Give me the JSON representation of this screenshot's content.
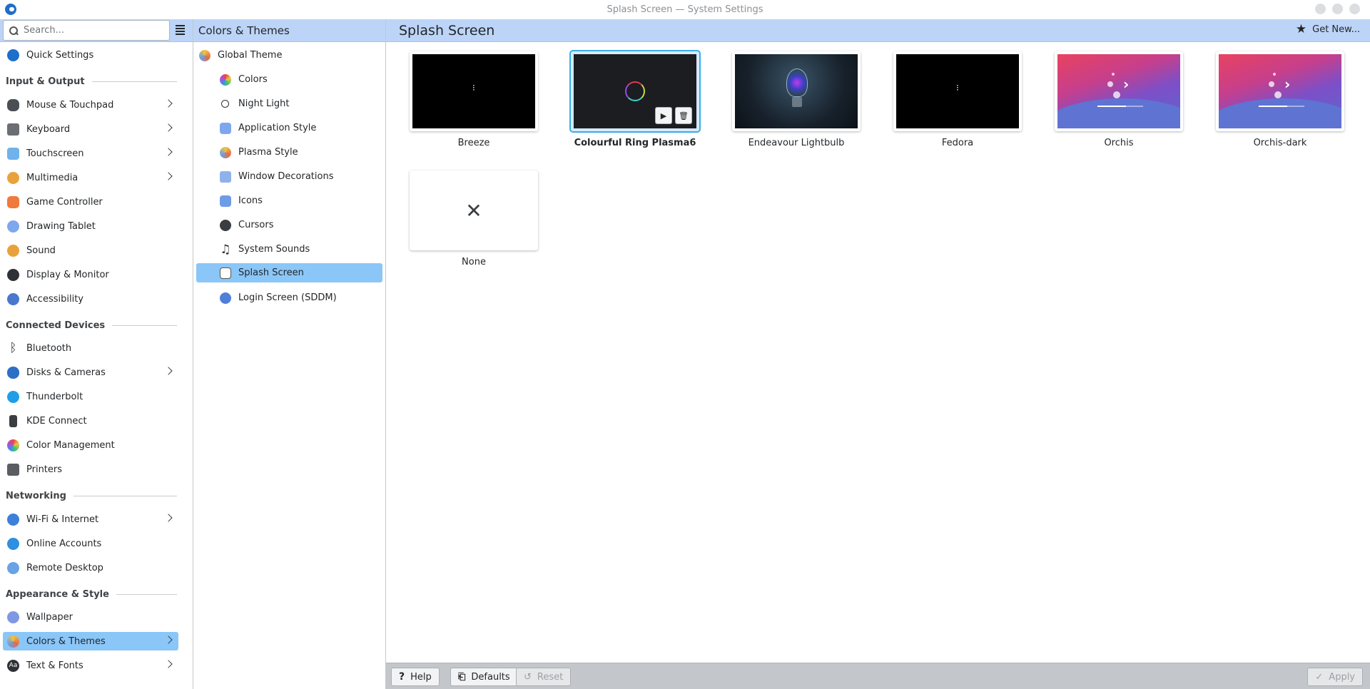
{
  "window": {
    "title": "Splash Screen — System Settings"
  },
  "header": {
    "search_placeholder": "Search...",
    "middle_title": "Colors & Themes",
    "page_title": "Splash Screen",
    "get_new_label": "Get New..."
  },
  "sidebar": {
    "quick_settings": "Quick Settings",
    "sections": {
      "input_output": "Input & Output",
      "connected_devices": "Connected Devices",
      "networking": "Networking",
      "appearance_style": "Appearance & Style"
    },
    "items": {
      "mouse": "Mouse & Touchpad",
      "keyboard": "Keyboard",
      "touchscreen": "Touchscreen",
      "multimedia": "Multimedia",
      "game_controller": "Game Controller",
      "drawing_tablet": "Drawing Tablet",
      "sound": "Sound",
      "display": "Display & Monitor",
      "accessibility": "Accessibility",
      "bluetooth": "Bluetooth",
      "disks": "Disks & Cameras",
      "thunderbolt": "Thunderbolt",
      "kde_connect": "KDE Connect",
      "color_management": "Color Management",
      "printers": "Printers",
      "wifi": "Wi-Fi & Internet",
      "online_accounts": "Online Accounts",
      "remote_desktop": "Remote Desktop",
      "wallpaper": "Wallpaper",
      "colors_themes": "Colors & Themes",
      "text_fonts": "Text & Fonts"
    }
  },
  "middle": {
    "global_theme": "Global Theme",
    "colors": "Colors",
    "night_light": "Night Light",
    "application_style": "Application Style",
    "plasma_style": "Plasma Style",
    "window_decorations": "Window Decorations",
    "icons": "Icons",
    "cursors": "Cursors",
    "system_sounds": "System Sounds",
    "splash_screen": "Splash Screen",
    "login_screen": "Login Screen (SDDM)"
  },
  "themes": {
    "breeze": "Breeze",
    "colourful_ring": "Colourful Ring Plasma6",
    "endeavour": "Endeavour Lightbulb",
    "fedora": "Fedora",
    "orchis": "Orchis",
    "orchis_dark": "Orchis-dark",
    "none": "None"
  },
  "footer": {
    "help": "Help",
    "defaults": "Defaults",
    "reset": "Reset",
    "apply": "Apply"
  },
  "colors": {
    "accent": "#3daee9",
    "selection": "#8ac6f8",
    "header_bg": "#bcd4f7"
  }
}
